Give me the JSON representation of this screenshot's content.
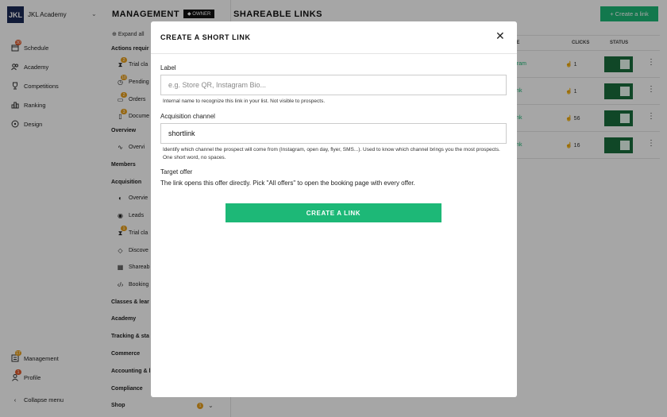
{
  "brand": {
    "logo": "JKL",
    "name": "JKL Academy"
  },
  "nav": {
    "items": [
      {
        "label": "Schedule",
        "icon": "calendar-icon",
        "badge": "30"
      },
      {
        "label": "Academy",
        "icon": "users-icon"
      },
      {
        "label": "Competitions",
        "icon": "trophy-icon"
      },
      {
        "label": "Ranking",
        "icon": "ranking-icon"
      },
      {
        "label": "Design",
        "icon": "palette-icon"
      }
    ],
    "bottom": [
      {
        "label": "Management",
        "icon": "management-icon",
        "badge": "17"
      },
      {
        "label": "Profile",
        "icon": "profile-icon",
        "badge": "1"
      }
    ],
    "collapse": "Collapse menu"
  },
  "management": {
    "title": "MANAGEMENT",
    "owner_badge": "OWNER",
    "expand_all": "Expand all",
    "sections": {
      "actions": "Actions requir",
      "overview": "Overview",
      "members": "Members",
      "acquisition": "Acquisition",
      "classes": "Classes & lear",
      "academy": "Academy",
      "tracking": "Tracking & sta",
      "commerce": "Commerce",
      "accounting": "Accounting & l",
      "compliance": "Compliance",
      "shop": "Shop"
    },
    "actions_items": [
      {
        "label": "Trial cla",
        "badge": "2"
      },
      {
        "label": "Pending",
        "badge": "10"
      },
      {
        "label": "Orders",
        "badge": "2"
      },
      {
        "label": "Docume",
        "badge": "3"
      }
    ],
    "overview_items": [
      {
        "label": "Overvi"
      }
    ],
    "acquisition_items": [
      {
        "label": "Overvie"
      },
      {
        "label": "Leads"
      },
      {
        "label": "Trial cla",
        "badge": "1"
      },
      {
        "label": "Discove"
      },
      {
        "label": "Shareab"
      },
      {
        "label": "Booking"
      }
    ],
    "shop_badge": "1"
  },
  "main": {
    "title": "SHAREABLE LINKS",
    "create_button": "+ Create a link",
    "columns": {
      "source": "CE",
      "clicks": "CLICKS",
      "status": "STATUS"
    },
    "rows": [
      {
        "channel": "gram",
        "clicks": "1"
      },
      {
        "channel": "link",
        "clicks": "1"
      },
      {
        "channel": "link",
        "clicks": "56"
      },
      {
        "channel": "link",
        "clicks": "16"
      }
    ]
  },
  "modal": {
    "title": "CREATE A SHORT LINK",
    "label_label": "Label",
    "label_placeholder": "e.g. Store QR, Instagram Bio...",
    "label_help": "Internal name to recognize this link in your list. Not visible to prospects.",
    "channel_label": "Acquisition channel",
    "channel_value": "shortlink",
    "channel_help": "Identify which channel the prospect will come from (Instagram, open day, flyer, SMS...). Used to know which channel brings you the most prospects. One short word, no spaces.",
    "offer_label": "Target offer",
    "offer_text": "The link opens this offer directly. Pick \"All offers\" to open the booking page with every offer.",
    "submit": "CREATE A LINK"
  },
  "colors": {
    "accent": "#1db877",
    "toggle": "#1a6e3c",
    "badge": "#e05a2b",
    "logo": "#1b2a57"
  }
}
